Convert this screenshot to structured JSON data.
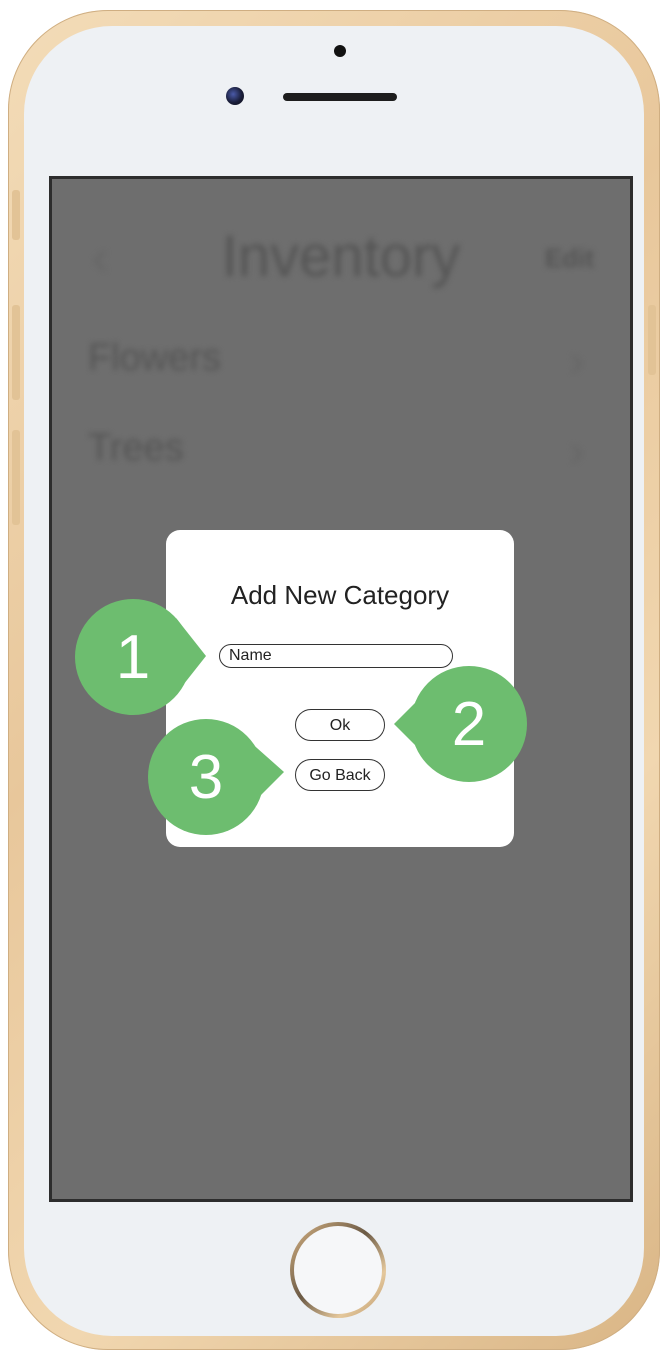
{
  "background_app": {
    "back_glyph": "‹",
    "title": "Inventory",
    "edit_label": "Edit",
    "rows": [
      {
        "label": "Flowers",
        "chevron": "›"
      },
      {
        "label": "Trees",
        "chevron": "›"
      }
    ]
  },
  "dialog": {
    "title": "Add New Category",
    "name_placeholder": "Name",
    "ok_label": "Ok",
    "go_back_label": "Go Back"
  },
  "callouts": [
    {
      "number": "1",
      "target": "name-input"
    },
    {
      "number": "2",
      "target": "ok-button"
    },
    {
      "number": "3",
      "target": "go-back-button"
    }
  ],
  "colors": {
    "callout_green": "#6dbd6f",
    "screen_dim": "#6e6e6e",
    "dialog_bg": "#ffffff"
  }
}
